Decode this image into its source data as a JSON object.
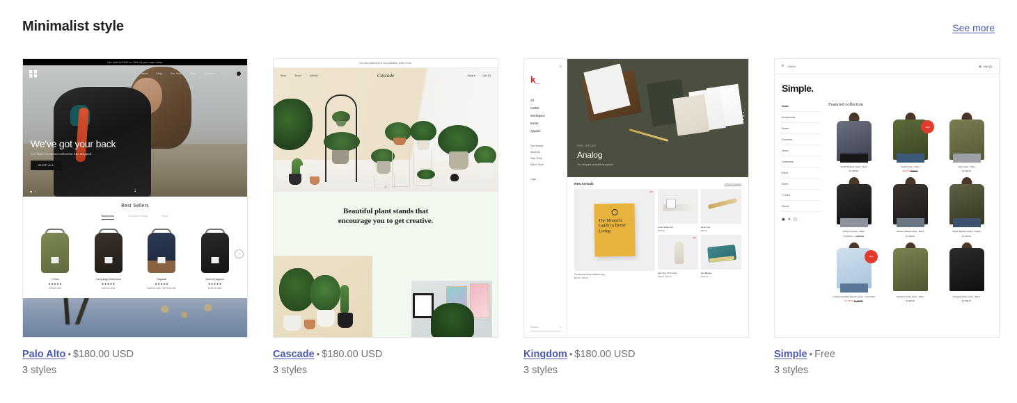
{
  "header": {
    "title": "Minimalist style",
    "see_more": "See more"
  },
  "cards": [
    {
      "name": "Palo Alto",
      "price": "$180.00 USD",
      "styles": "3 styles",
      "separator": "•",
      "preview": {
        "promo": "Use code ALPINE for 15% off your order today.",
        "nav": [
          "Home",
          "Shop",
          "Our Story",
          "Blog",
          "Contact"
        ],
        "hero_heading": "We've got your back",
        "hero_sub": "Our latest seasonal collection has dropped",
        "hero_button": "SHOP ALL",
        "section_title": "Best Sellers",
        "tabs": [
          "Backpacks",
          "Commuter Bags",
          "Travel"
        ],
        "products": [
          {
            "name": "Y-Pack",
            "stars": "★★★★★",
            "price": "$79.00 USD"
          },
          {
            "name": "Carryology Klettersack",
            "stars": "★★★★★",
            "price": "$249.00 USD"
          },
          {
            "name": "Daypack",
            "stars": "★★★★★",
            "price": "$169.00 USD - $179.00 USD"
          },
          {
            "name": "Denver Daypack",
            "stars": "★★★★★",
            "price": "$199.00 USD"
          }
        ]
      }
    },
    {
      "name": "Cascade",
      "price": "$180.00 USD",
      "styles": "3 styles",
      "separator": "•",
      "preview": {
        "promo": "Our new plant book is now available, order it here.",
        "nav": [
          "Shop",
          "About",
          "Articles"
        ],
        "brand": "Cascade",
        "utility": [
          "Search",
          "Cart (0)"
        ],
        "quote_line1": "Beautiful plant stands that",
        "quote_line2": "encourage you to get creative."
      }
    },
    {
      "name": "Kingdom",
      "price": "$180.00 USD",
      "styles": "3 styles",
      "separator": "•",
      "preview": {
        "logo": "k_",
        "nav": [
          "All",
          "Gather",
          "Workspace",
          "Books",
          "Apparel"
        ],
        "nav_secondary": [
          "Our Journal",
          "About Us",
          "Help / FAQ",
          "Get in Touch"
        ],
        "login": "Login",
        "search_placeholder": "Search...",
        "hero_kicker": "PRE-ORDER",
        "hero_heading": "Analog",
        "hero_sub": "The simplest productivity system",
        "arrivals_title": "New Arrivals",
        "arrivals_link": "View all products",
        "featured_book": "The Monocle Guide to Better Living",
        "products": [
          {
            "name": "The Monocle Guide to Better Living",
            "price": "$60.00 - $75.00",
            "badge": "Sale"
          },
          {
            "name": "Coffee Maker Set",
            "price": "$120.00",
            "badge": ""
          },
          {
            "name": "Desk Knife",
            "price": "$85.00",
            "badge": ""
          },
          {
            "name": "Kinto Day Off Tumbler",
            "price": "$28.00 - $32.00",
            "badge": "Sale"
          },
          {
            "name": "Day Blanket",
            "price": "$150.00",
            "badge": ""
          }
        ]
      }
    },
    {
      "name": "Simple",
      "price": "Free",
      "styles": "3 styles",
      "separator": "•",
      "preview": {
        "search_placeholder": "Search",
        "cart": "Cart (1)",
        "logo": "Simple.",
        "nav": [
          "Home",
          "Accessories",
          "Denim",
          "Footwear",
          "Jeans",
          "Outerwear",
          "Pants",
          "Shirts",
          "T-Shirts",
          "Shorts"
        ],
        "social": [
          "facebook-icon",
          "twitter-icon",
          "instagram-icon"
        ],
        "collection_title": "Featured collection",
        "sale_badge": "Sale",
        "products": [
          {
            "name": "Stealth Bomber Jacket - Navy",
            "price": "$1,599.95",
            "was": "",
            "now": "",
            "status": ""
          },
          {
            "name": "Storm Jacket - Olive",
            "price": "",
            "was": "$999.95",
            "now": "$849.95",
            "status": "",
            "badge": "Sale"
          },
          {
            "name": "Gulf Jacket - Olive",
            "price": "$1,299.95",
            "was": "",
            "now": "",
            "status": ""
          },
          {
            "name": "Wolfpack Jacket - Black",
            "price": "$1,599.95",
            "was": "",
            "now": "",
            "status": "Sold Out"
          },
          {
            "name": "Operator Denim Jacket - Black",
            "price": "$1,399.95",
            "was": "",
            "now": "",
            "status": ""
          },
          {
            "name": "Stealth Bomber Jacket - Fatigue",
            "price": "$1,599.95",
            "was": "",
            "now": "",
            "status": ""
          },
          {
            "name": "Compound Denim Pullover Jacket - Acid Wash",
            "price": "",
            "was": "$1,799.95",
            "now": "$1,599.95",
            "status": "",
            "badge": "Sale"
          },
          {
            "name": "Navigator Parka Jacket - Olive",
            "price": "$1,999.95",
            "was": "",
            "now": "",
            "status": ""
          },
          {
            "name": "Navigator Parka Jacket - Black",
            "price": "$1,999.95",
            "was": "",
            "now": "",
            "status": ""
          }
        ]
      }
    }
  ],
  "colors": {
    "link": "#4b5aad",
    "text": "#202223",
    "muted": "#6d7175",
    "border": "#e4e5e7",
    "sale": "#e23b2e",
    "kingdom_red": "#e02020"
  }
}
